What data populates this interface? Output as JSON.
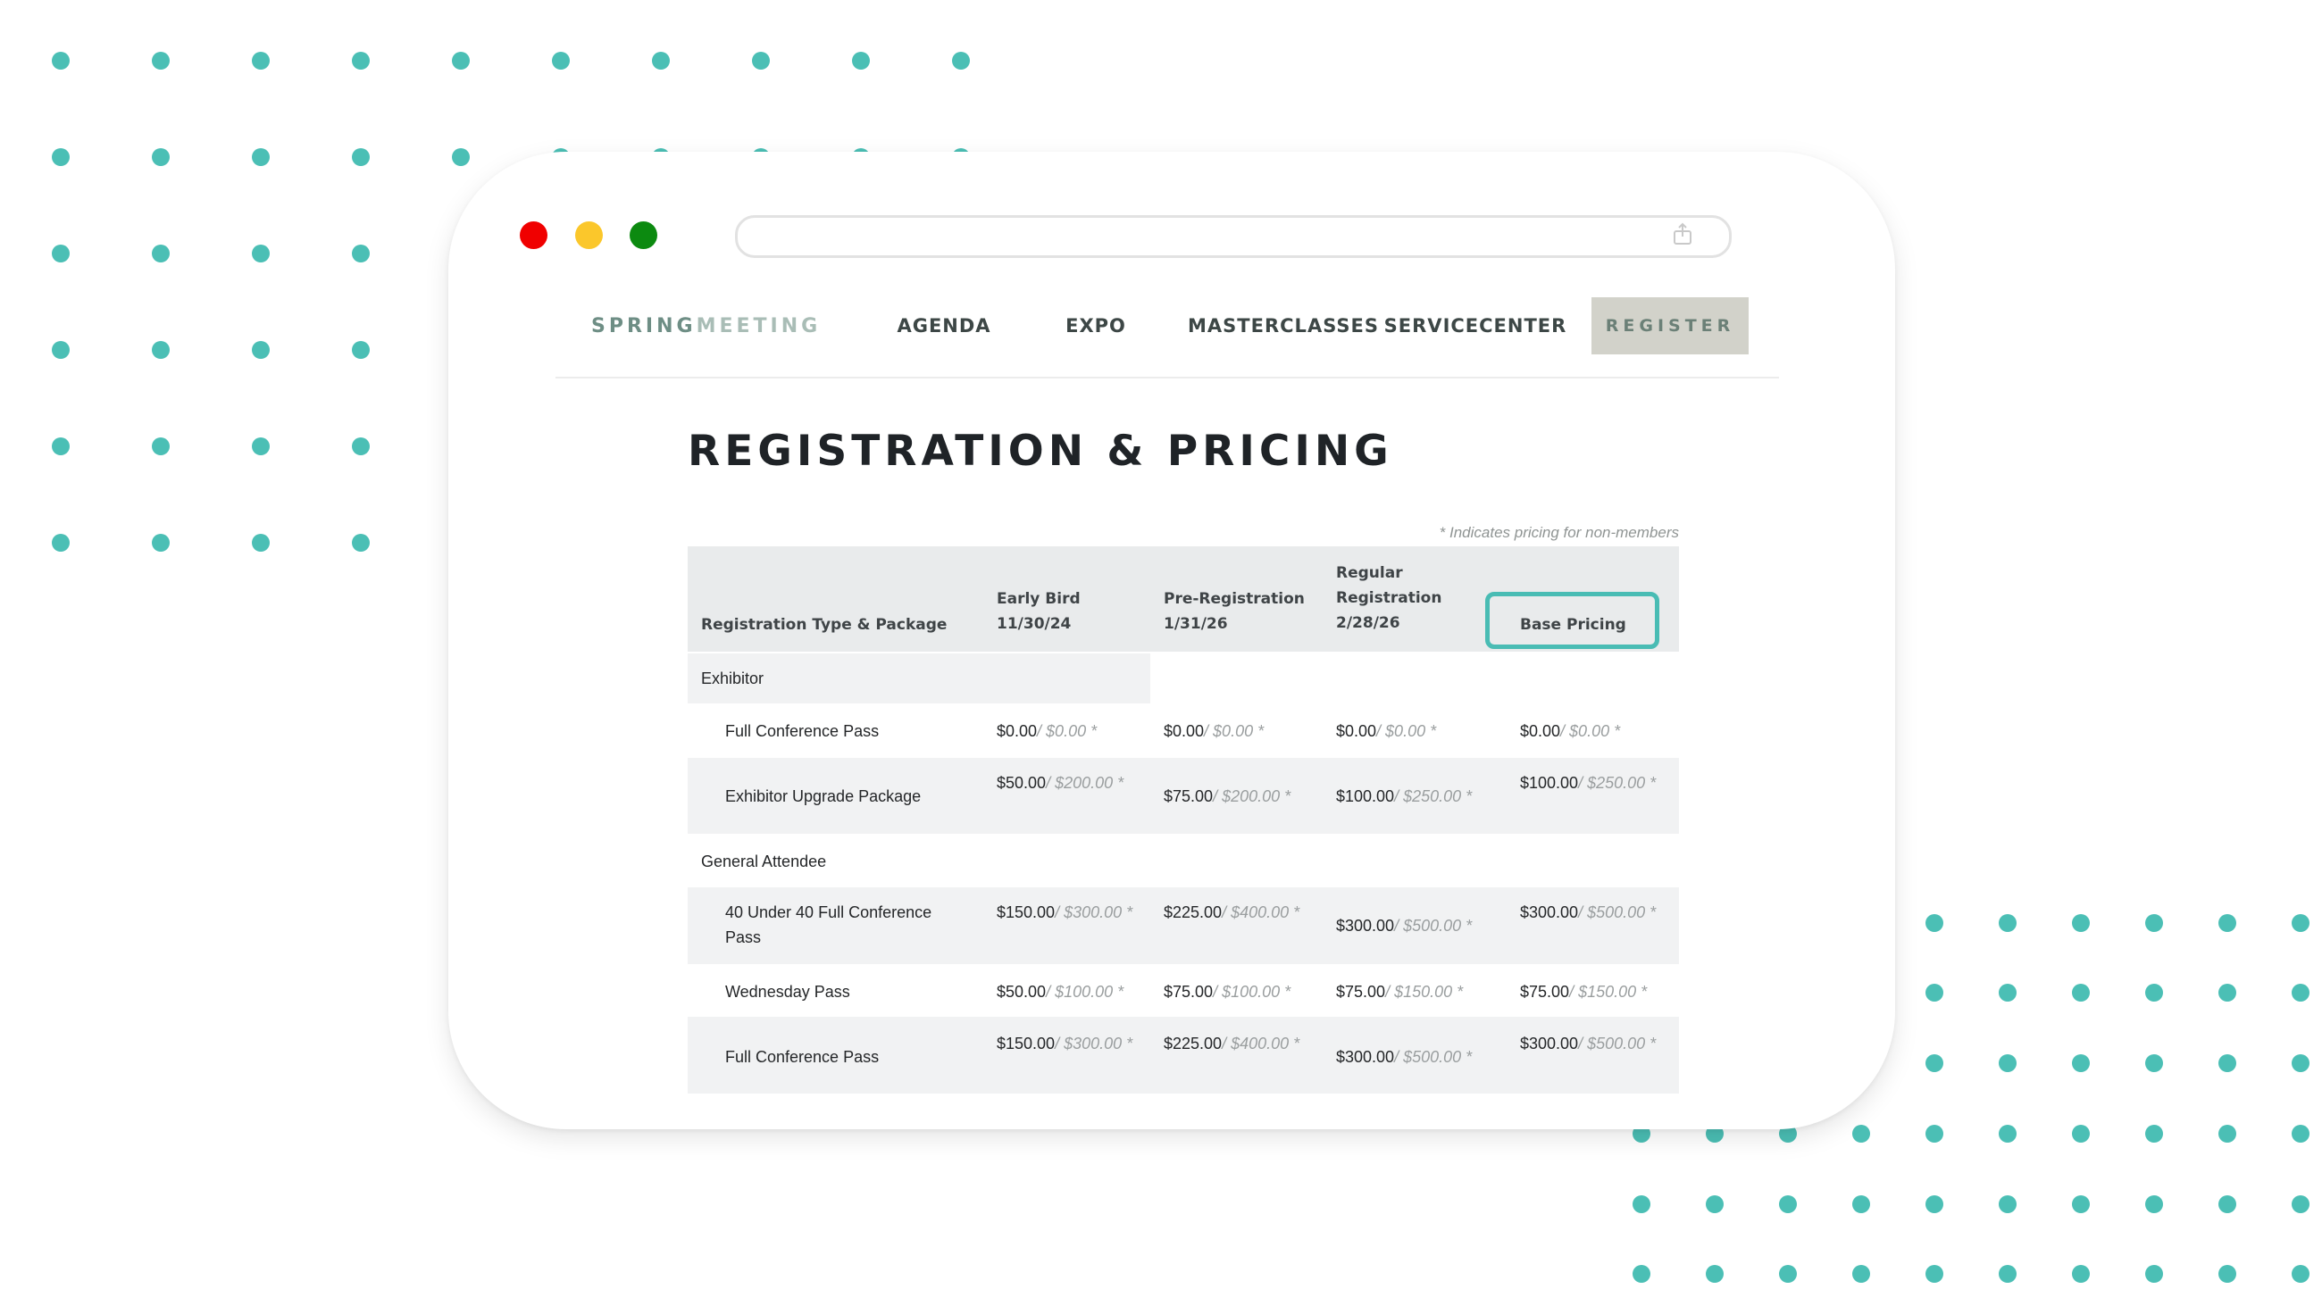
{
  "colors": {
    "dot": "#4bbfb5",
    "highlight": "#49bcb4",
    "register_bg": "#d2d2ca"
  },
  "window": {
    "url": ""
  },
  "icons": {
    "share": "share-icon"
  },
  "nav": {
    "brand_part1": "SPRING",
    "brand_part2": "MEETING",
    "agenda": "AGENDA",
    "expo": "EXPO",
    "masterclasses": "MASTERCLASSES",
    "service_line1": "SERVICE",
    "service_line2": "CENTER",
    "register": "REGISTER"
  },
  "page": {
    "title": "REGISTRATION & PRICING",
    "note": "* Indicates pricing for non-members"
  },
  "table": {
    "headers": {
      "type": "Registration Type & Package",
      "early_line1": "Early Bird",
      "early_line2": "11/30/24",
      "pre_line1": "Pre-Registration",
      "pre_line2": "1/31/26",
      "regular_line1": "Regular",
      "regular_line2": "Registration",
      "regular_line3": "2/28/26",
      "base": "Base Pricing"
    },
    "groups": [
      "Exhibitor",
      "General Attendee"
    ],
    "rows": [
      {
        "name": "Full Conference Pass",
        "prices": [
          {
            "m": "$0.00",
            "n": "/ $0.00 *"
          },
          {
            "m": "$0.00",
            "n": "/ $0.00 *"
          },
          {
            "m": "$0.00",
            "n": "/ $0.00 *"
          },
          {
            "m": "$0.00",
            "n": "/ $0.00 *"
          }
        ]
      },
      {
        "name": "Exhibitor Upgrade Package",
        "prices": [
          {
            "m": "$50.00",
            "n": "/ $200.00 *"
          },
          {
            "m": "$75.00",
            "n": "/ $200.00 *"
          },
          {
            "m": "$100.00",
            "n": "/ $250.00 *"
          },
          {
            "m": "$100.00",
            "n": "/ $250.00 *"
          }
        ]
      },
      {
        "name": "40 Under 40 Full Conference Pass",
        "prices": [
          {
            "m": "$150.00",
            "n": "/ $300.00 *"
          },
          {
            "m": "$225.00",
            "n": "/ $400.00 *"
          },
          {
            "m": "$300.00",
            "n": "/ $500.00 *"
          },
          {
            "m": "$300.00",
            "n": "/ $500.00 *"
          }
        ]
      },
      {
        "name": "Wednesday Pass",
        "prices": [
          {
            "m": "$50.00",
            "n": "/ $100.00 *"
          },
          {
            "m": "$75.00",
            "n": "/ $100.00 *"
          },
          {
            "m": "$75.00",
            "n": "/ $150.00 *"
          },
          {
            "m": "$75.00",
            "n": "/ $150.00 *"
          }
        ]
      },
      {
        "name": "Full Conference Pass",
        "prices": [
          {
            "m": "$150.00",
            "n": "/ $300.00 *"
          },
          {
            "m": "$225.00",
            "n": "/ $400.00 *"
          },
          {
            "m": "$300.00",
            "n": "/ $500.00 *"
          },
          {
            "m": "$300.00",
            "n": "/ $500.00 *"
          }
        ]
      }
    ]
  }
}
